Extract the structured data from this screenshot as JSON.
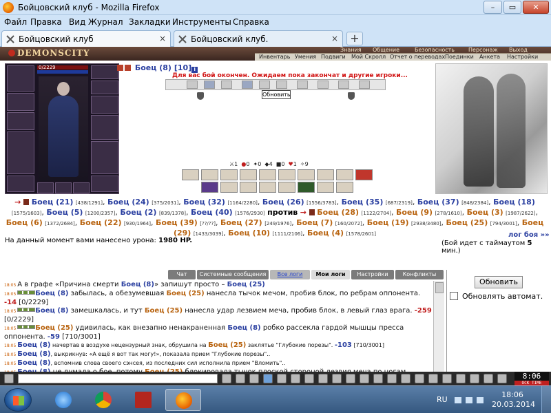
{
  "window": {
    "title": "Бойцовский клуб - Mozilla Firefox",
    "min": "–",
    "max": "▭",
    "close": "✕"
  },
  "menu": [
    "Файл",
    "Правка",
    "Вид",
    "Журнал",
    "Закладки",
    "Инструменты",
    "Справка"
  ],
  "tabs": [
    {
      "label": "Бойцовский клуб",
      "close": "×"
    },
    {
      "label": "Бойцовский клуб.",
      "close": "×"
    }
  ],
  "newtab": "+",
  "site": {
    "logo": "DEMONSCITY",
    "nav_top": [
      "Знания",
      "Общение",
      "Безопасность",
      "Персонаж",
      "Выход"
    ],
    "nav_sub": [
      "Инвентарь",
      "Умения",
      "Подвиги",
      "Мой Скролл",
      "Отчет о переводах",
      "Поединки",
      "Анкета",
      "Настройки"
    ],
    "char": {
      "hp": "0/2229",
      "mp": "5/5",
      "hp_ratio": 0
    },
    "battle": {
      "name": "Боец",
      "level": "(8)",
      "ns": "[10]",
      "status": "Для вас бой окончен. Ожидаем пока закончат и другие игроки...",
      "tooltip": "Обновить",
      "stats": [
        "1",
        "0",
        "0",
        "4",
        "0",
        "1",
        "9"
      ]
    },
    "blue_team": [
      {
        "name": "Боец",
        "lv": "(21)",
        "hp": "[438/1291]"
      },
      {
        "name": "Боец",
        "lv": "(24)",
        "hp": "[375/2031]"
      },
      {
        "name": "Боец",
        "lv": "(32)",
        "hp": "[1164/2280]"
      },
      {
        "name": "Боец",
        "lv": "(26)",
        "hp": "[1556/3783]"
      },
      {
        "name": "Боец",
        "lv": "(35)",
        "hp": "[687/2319]"
      },
      {
        "name": "Боец",
        "lv": "(37)",
        "hp": "[848/2384]"
      },
      {
        "name": "Боец",
        "lv": "(18)",
        "hp": "[1575/1603]"
      },
      {
        "name": "Боец",
        "lv": "(5)",
        "hp": "[1200/2357]"
      },
      {
        "name": "Боец",
        "lv": "(2)",
        "hp": "[839/1378]"
      },
      {
        "name": "Боец",
        "lv": "(40)",
        "hp": "[1576/2930]"
      }
    ],
    "versus": "против",
    "orange_team": [
      {
        "name": "Боец",
        "lv": "(28)",
        "hp": "[1122/2704]"
      },
      {
        "name": "Боец",
        "lv": "(9)",
        "hp": "[278/1610]"
      },
      {
        "name": "Боец",
        "lv": "(3)",
        "hp": "[1987/2622]"
      },
      {
        "name": "Боец",
        "lv": "(6)",
        "hp": "[1372/2684]"
      },
      {
        "name": "Боец",
        "lv": "(22)",
        "hp": "[930/1964]"
      },
      {
        "name": "Боец",
        "lv": "(39)",
        "hp": "[??/??]"
      },
      {
        "name": "Боец",
        "lv": "(27)",
        "hp": "[249/1976]"
      },
      {
        "name": "Боец",
        "lv": "(7)",
        "hp": "[160/2072]"
      },
      {
        "name": "Боец",
        "lv": "(19)",
        "hp": "[2938/3480]"
      },
      {
        "name": "Боец",
        "lv": "(25)",
        "hp": "[794/3001]"
      },
      {
        "name": "Боец",
        "lv": "(29)",
        "hp": "[1433/3039]"
      },
      {
        "name": "Боец",
        "lv": "(10)",
        "hp": "[1111/2106]"
      },
      {
        "name": "Боец",
        "lv": "(4)",
        "hp": "[1578/2601]"
      }
    ],
    "damage_text": "На данный момент вами нанесено урона:",
    "damage_value": "1980 HP.",
    "log_link": "лог боя »»",
    "timeout_pre": "(Бой идет с таймаутом",
    "timeout_num": "5",
    "timeout_post": "мин.)"
  },
  "chat": {
    "tabs": [
      "Чат",
      "Системные сообщения",
      "Все логи",
      "Мои логи",
      "Настройки",
      "Конфликты"
    ],
    "refresh": "Обновить",
    "auto_refresh": "Обновлять автомат."
  },
  "log": [
    {
      "time": "18:05",
      "parts": [
        [
          "",
          "А в графе «Причина смерти "
        ],
        [
          "b",
          "Боец (8)"
        ],
        [
          "",
          "» запишут просто – "
        ],
        [
          "b",
          "Боец (25)"
        ]
      ]
    },
    {
      "time": "18:05",
      "icon": true,
      "parts": [
        [
          "b",
          "Боец (8)"
        ],
        [
          "",
          " забылась, а обезумевшая "
        ],
        [
          "o",
          "Боец (25)"
        ],
        [
          "",
          " нанесла тычок мечом, пробив блок, по ребрам оппонента. "
        ],
        [
          "red",
          "-14"
        ],
        [
          "",
          " [0/2229]"
        ]
      ]
    },
    {
      "time": "18:05",
      "icon": true,
      "parts": [
        [
          "b",
          "Боец (8)"
        ],
        [
          "",
          " замешкалась, и тут "
        ],
        [
          "o",
          "Боец (25)"
        ],
        [
          "",
          " нанесла удар лезвием меча, пробив блок, в левый глаз врага. "
        ],
        [
          "red",
          "-259"
        ],
        [
          "",
          " [0/2229]"
        ]
      ]
    },
    {
      "time": "18:05",
      "icon": true,
      "parts": [
        [
          "o",
          "Боец (25)"
        ],
        [
          "",
          " удивилась, как внезапно ненакраненная "
        ],
        [
          "b",
          "Боец (8)"
        ],
        [
          "",
          " робко рассекла гардой мышцы пресса оппонента. "
        ],
        [
          "blue",
          "-59"
        ],
        [
          "",
          " [710/3001]"
        ]
      ]
    },
    {
      "time": "18:05",
      "parts": [
        [
          "b",
          "Боец (8)"
        ],
        [
          "sm",
          " начертав в воздухе нецензурный знак, обрушила на "
        ],
        [
          "o",
          "Боец (25)"
        ],
        [
          "sm",
          " заклятье "
        ],
        [
          "sm",
          "\"Глубокие порезы\""
        ],
        [
          "sm",
          ". "
        ],
        [
          "blue",
          "-103"
        ],
        [
          "sm",
          " [710/3001]"
        ]
      ]
    },
    {
      "time": "18:05",
      "parts": [
        [
          "b",
          "Боец (8)"
        ],
        [
          "sm",
          ", выкрикнув: «А ещё я вот так могу!», показала прием "
        ],
        [
          "sm",
          "\"Глубокие порезы\""
        ],
        [
          "sm",
          ".."
        ]
      ]
    },
    {
      "time": "18:05",
      "parts": [
        [
          "b",
          "Боец (8)"
        ],
        [
          "sm",
          ", вспомнив слова своего сэнсея, из последних сил исполнила прием "
        ],
        [
          "sm",
          "\"Вломить\""
        ],
        [
          "sm",
          ".."
        ]
      ]
    },
    {
      "time": "18:05",
      "parts": [
        [
          "b",
          "Боец (8)"
        ],
        [
          "",
          " не думала о бое, потому "
        ],
        [
          "o",
          "Боец (25)"
        ],
        [
          "",
          " блокировала тычок плоской стороной лезвия меча по ногам."
        ]
      ]
    }
  ],
  "input_clock": {
    "time": "8:06",
    "tag": "ОСК TIME"
  },
  "taskbar": {
    "lang": "RU",
    "time": "18:06",
    "date": "20.03.2014"
  }
}
